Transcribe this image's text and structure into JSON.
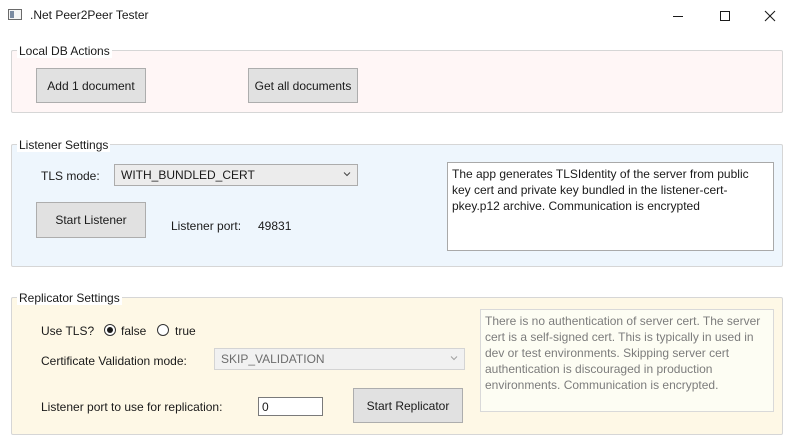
{
  "window": {
    "title": ".Net Peer2Peer Tester",
    "icons": {
      "app": "app-window-icon",
      "minimize": "minimize-icon",
      "maximize": "maximize-icon",
      "close": "close-icon"
    }
  },
  "local_db": {
    "legend": "Local DB Actions",
    "add_button": "Add 1 document",
    "get_all_button": "Get all documents",
    "background": "#fff6f6"
  },
  "listener": {
    "legend": "Listener Settings",
    "tls_mode_label": "TLS mode:",
    "tls_mode_value": "WITH_BUNDLED_CERT",
    "start_button": "Start Listener",
    "port_label": "Listener port:",
    "port_value": "49831",
    "description": "The app generates TLSIdentity of the server from public key cert and private key bundled in the listener-cert-pkey.p12 archive. Communication is encrypted",
    "background": "#eef6fd"
  },
  "replicator": {
    "legend": "Replicator Settings",
    "use_tls_label": "Use TLS?",
    "tls_options": [
      {
        "label": "false",
        "checked": true
      },
      {
        "label": "true",
        "checked": false
      }
    ],
    "cert_mode_label": "Certificate Validation mode:",
    "cert_mode_value": "SKIP_VALIDATION",
    "port_label": "Listener port to use for replication:",
    "port_value": "0",
    "start_button": "Start Replicator",
    "description": "There is no authentication of server cert. The server cert is a self-signed cert. This is typically in used in dev or test environments. Skipping server cert authentication is discouraged in production environments. Communication is encrypted.",
    "background": "#fef8e6"
  }
}
